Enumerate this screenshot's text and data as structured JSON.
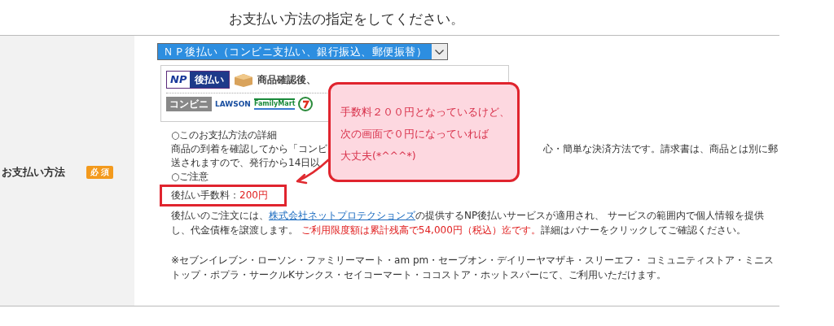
{
  "title": "お支払い方法の指定をしてください。",
  "field": {
    "label": "お支払い方法",
    "required_badge": "必 須"
  },
  "select": {
    "value": "ＮＰ後払い（コンビニ支払い、銀行振込、郵便振替）"
  },
  "banner": {
    "logo_mark": "NP",
    "logo_text": "後払い",
    "text": "商品確認後、",
    "stores": [
      {
        "name": "コンビニ",
        "kind": "tag"
      },
      {
        "name": "LAWSON",
        "kind": "lawson"
      },
      {
        "name": "FamilyMart",
        "kind": "familymart"
      }
    ]
  },
  "details": {
    "heading": "○このお支払方法の詳細",
    "line_1_left": "商品の到着を確認してから「コンビ",
    "line_1_right": "心・簡単な決済方法です。請求書は、商品とは別に郵",
    "line_2": "送されますので、発行から14日以",
    "notice_heading": "○ご注意",
    "fee_label": "後払い手数料：",
    "fee_value": "200円",
    "paragraph": [
      {
        "kind": "text",
        "text": "後払いのご注文には、"
      },
      {
        "kind": "link",
        "text": "株式会社ネットプロテクションズ"
      },
      {
        "kind": "text",
        "text": "の提供するNP後払いサービスが適用され、 サービスの範囲内で個人情報を提供し、代金債権を譲渡します。 "
      },
      {
        "kind": "alert",
        "text": "ご利用限度額は累計残高で54,000円（税込）迄です。"
      },
      {
        "kind": "text",
        "text": "詳細はバナーをクリックしてご確認ください。"
      }
    ],
    "stores_note": "※セブンイレブン・ローソン・ファミリーマート・am pm・セーブオン・デイリーヤマザキ・スリーエフ・ コミュニティストア・ミニストップ・ポプラ・サークルKサンクス・セイコーマート・ココストア・ホットスパーにて、ご利用いただけます。"
  },
  "callout": {
    "lines": [
      "手数料２００円となっているけど、",
      "次の画面で０円になっていれば",
      "大丈夫(*^^^*)"
    ]
  }
}
